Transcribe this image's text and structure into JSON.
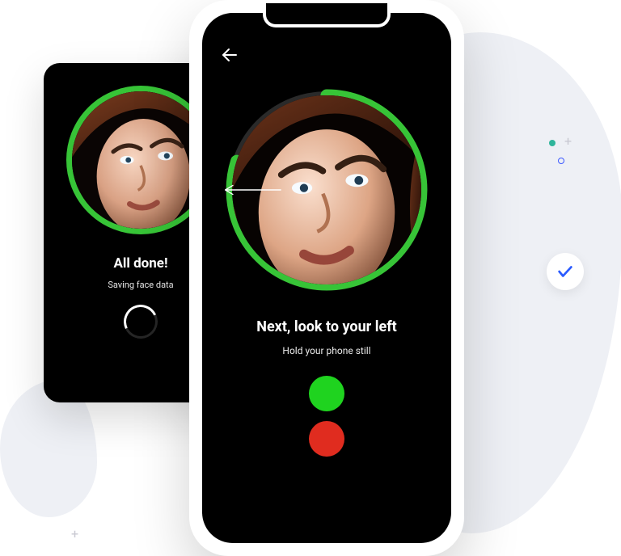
{
  "colors": {
    "accent_ring": "#37c437",
    "progress_track": "#2a2a2a",
    "status_green": "#1fd31f",
    "status_red": "#e02c1f"
  },
  "icons": {
    "back": "arrow-left",
    "direction": "arrow-left-long",
    "check": "check"
  },
  "back_card": {
    "title": "All done!",
    "subtitle": "Saving face data",
    "ring_progress_pct": 100
  },
  "front_phone": {
    "title": "Next, look to your left",
    "subtitle": "Hold your phone still",
    "ring_progress_pct": 80,
    "status": {
      "top": "green",
      "bottom": "red"
    }
  }
}
